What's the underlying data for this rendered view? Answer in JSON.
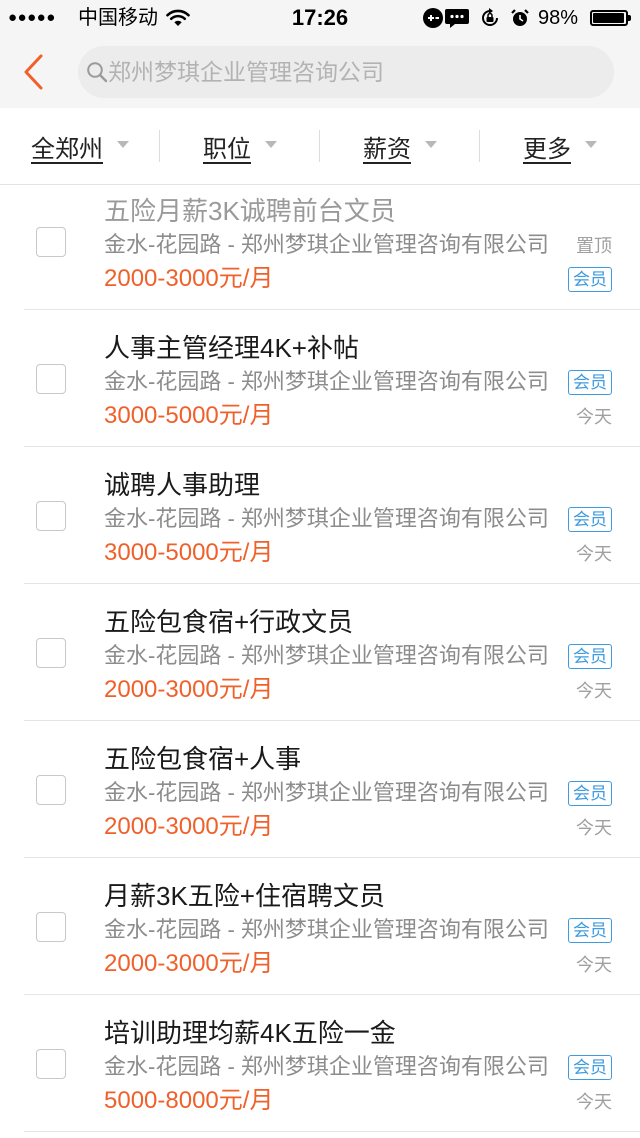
{
  "status_bar": {
    "signal": "●●●●●",
    "carrier": "中国移动",
    "time": "17:26",
    "battery": "98%",
    "battery_level": 0.98,
    "icons": [
      "wifi-icon",
      "link-icon",
      "chat-icon",
      "rotation-lock-icon",
      "alarm-icon",
      "battery-icon"
    ]
  },
  "header": {
    "back_icon": "chevron-left-icon",
    "search_icon": "search-icon",
    "search_placeholder": "郑州梦琪企业管理咨询公司"
  },
  "filters": [
    {
      "label": "全郑州"
    },
    {
      "label": "职位"
    },
    {
      "label": "薪资"
    },
    {
      "label": "更多"
    }
  ],
  "jobs": [
    {
      "title": "五险月薪3K诚聘前台文员",
      "company": "金水-花园路 - 郑州梦琪企业管理咨询有限公司",
      "salary": "2000-3000元/月",
      "pinned": "置顶",
      "badge": "会员",
      "title_color": "#9a9a9a"
    },
    {
      "title": "人事主管经理4K+补帖",
      "company": "金水-花园路 - 郑州梦琪企业管理咨询有限公司",
      "salary": "3000-5000元/月",
      "badge": "会员",
      "posted": "今天"
    },
    {
      "title": "诚聘人事助理",
      "company": "金水-花园路 - 郑州梦琪企业管理咨询有限公司",
      "salary": "3000-5000元/月",
      "badge": "会员",
      "posted": "今天"
    },
    {
      "title": "五险包食宿+行政文员",
      "company": "金水-花园路 - 郑州梦琪企业管理咨询有限公司",
      "salary": "2000-3000元/月",
      "badge": "会员",
      "posted": "今天"
    },
    {
      "title": "五险包食宿+人事",
      "company": "金水-花园路 - 郑州梦琪企业管理咨询有限公司",
      "salary": "2000-3000元/月",
      "badge": "会员",
      "posted": "今天"
    },
    {
      "title": "月薪3K五险+住宿聘文员",
      "company": "金水-花园路 - 郑州梦琪企业管理咨询有限公司",
      "salary": "2000-3000元/月",
      "badge": "会员",
      "posted": "今天"
    },
    {
      "title": "培训助理均薪4K五险一金",
      "company": "金水-花园路 - 郑州梦琪企业管理咨询有限公司",
      "salary": "5000-8000元/月",
      "badge": "会员",
      "posted": "今天"
    }
  ],
  "colors": {
    "accent": "#f0602a",
    "badge": "#3d9be0",
    "text": "#1a1a1a",
    "muted": "#8c8c8c"
  }
}
